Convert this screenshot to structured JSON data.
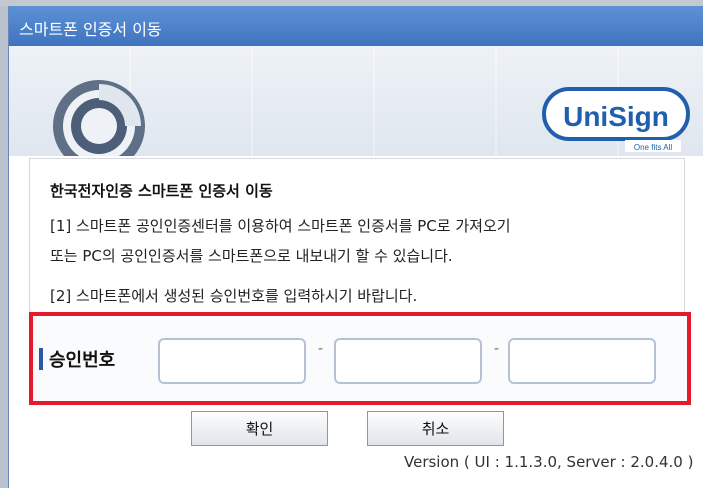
{
  "window": {
    "title": "스마트폰 인증서 이동"
  },
  "logo": {
    "brand_pre": "Uni",
    "brand_post": "Sign",
    "tagline": "One fits All"
  },
  "content": {
    "heading": "한국전자인증 스마트폰 인증서 이동",
    "line1": "[1] 스마트폰 공인인증센터를 이용하여 스마트폰 인증서를 PC로 가져오기",
    "line2": "또는 PC의 공인인증서를 스마트폰으로 내보내기 할 수 있습니다.",
    "line3": "[2] 스마트폰에서 생성된 승인번호를 입력하시기 바랍니다."
  },
  "approval": {
    "label": "승인번호",
    "separator": "-",
    "fields": [
      {
        "value": ""
      },
      {
        "value": ""
      },
      {
        "value": ""
      }
    ]
  },
  "buttons": {
    "ok": "확인",
    "cancel": "취소"
  },
  "version": "Version ( UI : 1.1.3.0, Server : 2.0.4.0 )",
  "colors": {
    "titlebar": "#4a7fcb",
    "highlight_border": "#e41a2c",
    "label_bar": "#2a57a8",
    "logo": "#1f5fae"
  },
  "icons": [
    "globe-emblem-icon",
    "unisign-logo"
  ]
}
